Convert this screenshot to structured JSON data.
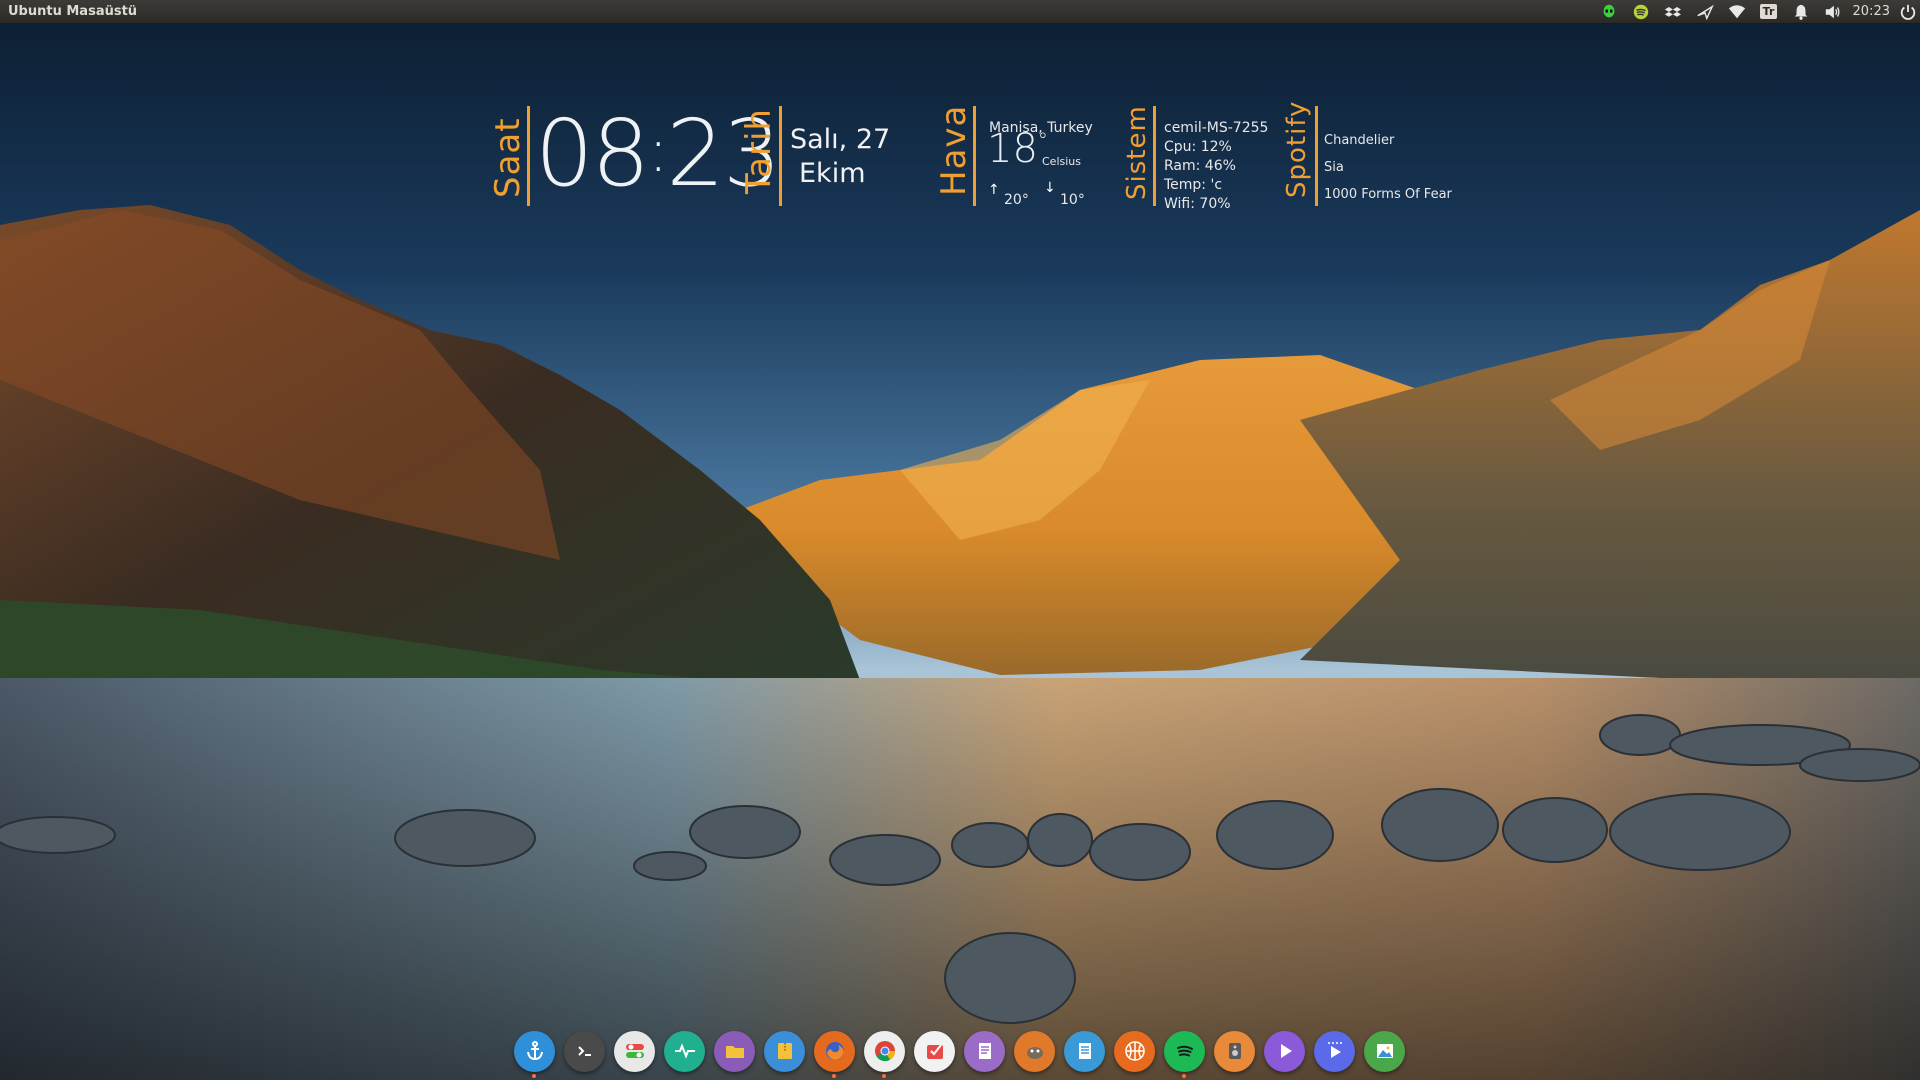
{
  "top_panel": {
    "title": "Ubuntu Masaüstü",
    "clock": "20:23",
    "keyboard_layout": "Tr",
    "tray_icons": [
      "alien-icon",
      "spotify-icon",
      "dropbox-icon",
      "plane-icon",
      "wifi-icon",
      "keyboard-layout-icon",
      "bell-icon",
      "volume-icon",
      "power-icon"
    ]
  },
  "clock_widget": {
    "label": "Saat",
    "hours": "08",
    "minutes": "23"
  },
  "date_widget": {
    "label": "Tarih",
    "day_line": "Salı, 27",
    "month": "Ekim"
  },
  "weather_widget": {
    "label": "Hava",
    "location": "Manisa, Turkey",
    "temperature": "18",
    "degree_symbol": "°",
    "unit": "Celsius",
    "high": "20°",
    "low": "10°"
  },
  "system_widget": {
    "label": "Sistem",
    "hostname": "cemil-MS-7255",
    "cpu": "Cpu: 12%",
    "ram": "Ram: 46%",
    "temp": "Temp:  'c",
    "wifi": "Wifi: 70%"
  },
  "spotify_widget": {
    "label": "Spotify",
    "track": "Chandelier",
    "artist": "Sia",
    "album": "1000 Forms Of Fear"
  },
  "dock": {
    "apps": [
      {
        "name": "anchor-icon",
        "color": "#2f8fd8"
      },
      {
        "name": "terminal-icon",
        "color": "#4a4a4a"
      },
      {
        "name": "settings-toggle-icon",
        "color": "#e8e8e8"
      },
      {
        "name": "system-monitor-icon",
        "color": "#21b08f"
      },
      {
        "name": "files-icon",
        "color": "#8a5cb8"
      },
      {
        "name": "archive-icon",
        "color": "#3a8fd8"
      },
      {
        "name": "firefox-icon",
        "color": "#e66a1e"
      },
      {
        "name": "chrome-icon",
        "color": "#eeeeee"
      },
      {
        "name": "todo-icon",
        "color": "#f2f2f2"
      },
      {
        "name": "text-editor-icon",
        "color": "#9a6cc8"
      },
      {
        "name": "gimp-icon",
        "color": "#e07a2a"
      },
      {
        "name": "document-viewer-icon",
        "color": "#3a9ad8"
      },
      {
        "name": "basketball-icon",
        "color": "#e86a1e"
      },
      {
        "name": "spotify-icon",
        "color": "#1db954"
      },
      {
        "name": "music-player-icon",
        "color": "#e88a3a"
      },
      {
        "name": "media-player-icon",
        "color": "#8a5ad8"
      },
      {
        "name": "video-player-icon",
        "color": "#5a6ae8"
      },
      {
        "name": "image-viewer-icon",
        "color": "#4aa84a"
      }
    ]
  }
}
